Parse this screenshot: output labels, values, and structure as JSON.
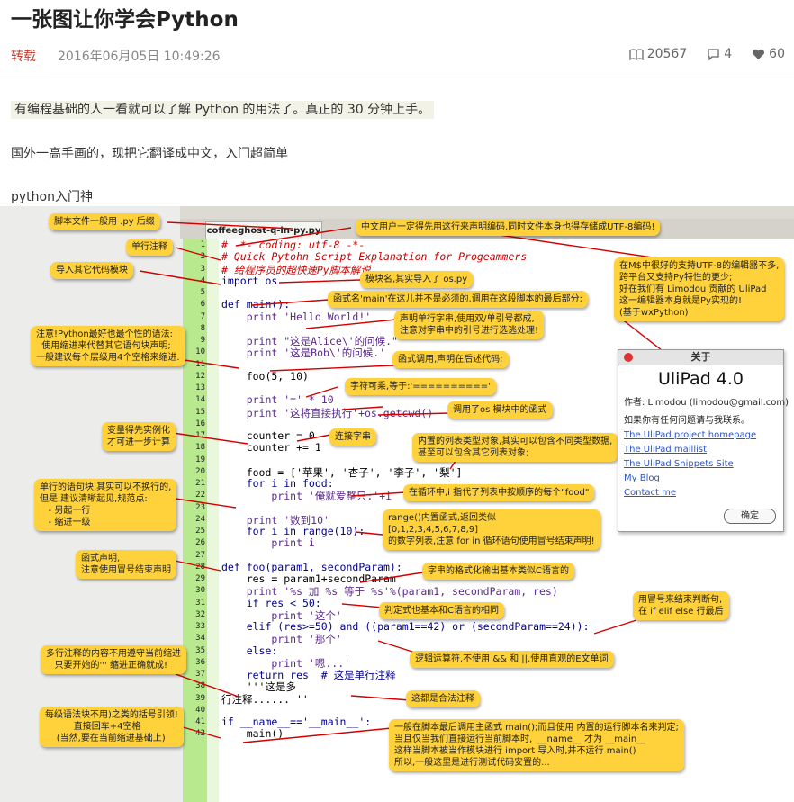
{
  "article": {
    "title": "一张图让你学会Python",
    "tag": "转载",
    "date": "2016年06月05日 10:49:26",
    "views": "20567",
    "comments": "4",
    "likes": "60",
    "para1": "有编程基础的人一看就可以了解 Python 的用法了。真正的 30 分钟上手。",
    "para2": "国外一高手画的，现把它翻译成中文，入门超简单",
    "para3": "python入门神"
  },
  "editor": {
    "tab": "coffeeghost-q-in-py.py",
    "line_numbers": [
      "1",
      "2",
      "3",
      "4",
      "5",
      "6",
      "7",
      "8",
      "9",
      "10",
      "11",
      "12",
      "13",
      "14",
      "15",
      "16",
      "17",
      "18",
      "19",
      "20",
      "21",
      "22",
      "23",
      "24",
      "25",
      "26",
      "27",
      "28",
      "29",
      "30",
      "31",
      "32",
      "33",
      "34",
      "35",
      "36",
      "37",
      "38",
      "39",
      "40",
      "41",
      "42"
    ],
    "lines": [
      "# -*- coding: utf-8 -*-",
      "# Quick Pytohn Script Explanation for Progeammers",
      "# 给程序员的超快速Py脚本解说",
      "import os",
      "",
      "def main():",
      "    print 'Hello World!'",
      "",
      "    print \"这是Alice\\'的问候.\"",
      "    print '这是Bob\\'的问候.'",
      "",
      "    foo(5, 10)",
      "",
      "    print '=' * 10",
      "    print '这将直接执行'+os.getcwd()",
      "",
      "    counter = 0",
      "    counter += 1",
      "",
      "    food = ['苹果', '杏子', '李子', '梨']",
      "    for i in food:",
      "        print '俺就爱整只:'+i",
      "",
      "    print '数到10'",
      "    for i in range(10):",
      "        print i",
      "",
      "def foo(param1, secondParam):",
      "    res = param1+secondParam",
      "    print '%s 加 %s 等于 %s'%(param1, secondParam, res)",
      "    if res < 50:",
      "        print '这个'",
      "    elif (res>=50) and ((param1==42) or (secondParam==24)):",
      "        print '那个'",
      "    else:",
      "        print '嗯...'",
      "    return res  # 这是单行注释",
      "    '''这是多",
      "行注释......'''",
      "",
      "if __name__=='__main__':",
      "    main()"
    ]
  },
  "notes": [
    "脚本文件一般用 .py 后缀",
    "中文用户一定得先用这行来声明编码,同时文件本身也得存储成UTF-8编码!",
    "单行注释",
    "导入其它代码模块",
    "模块名,其实导入了 os.py",
    "函式名'main'在这儿并不是必须的,调用在这段脚本的最后部分;",
    "在M$中很好的支持UTF-8的编辑器不多,\n跨平台又支持Py特性的更少;\n好在我们有 Limodou 贡献的 UliPad\n这一编辑器本身就是Py实现的!\n(基于wxPython)",
    "注意!Python最好也最个性的语法:\n  使用缩进来代替其它语句块声明;\n一般建议每个层级用4个空格来缩进.",
    "声明单行字串,使用双/单引号都成,\n注意对字串中的引号进行选逃处理!",
    "函式调用,声明在后述代码;",
    "字符可乘,等于:'=========='",
    "调用了os 模块中的函式",
    "变量得先实例化\n才可进一步计算",
    "连接字串",
    "内置的列表类型对象,其实可以包含不同类型数据,\n甚至可以包含其它列表对象;",
    "单行的语句块,其实可以不换行的,\n但是,建议清晰起见,规范点:\n   - 另起一行\n   - 缩进一级",
    "在循环中,i 指代了列表中按顺序的每个\"food\"",
    "range()内置函式,返回类似\n[0,1,2,3,4,5,6,7,8,9]\n的数字列表,注意 for in 循环语句使用冒号结束声明!",
    "函式声明,\n注意使用冒号结束声明",
    "字串的格式化输出基本类似C语言的",
    "判定式也基本和C语言的相同",
    "用冒号来结束判断句,\n在 if elif else 行最后",
    "逻辑运算符,不使用 && 和 ||,使用直观的E文单词",
    "多行注释的内容不用遵守当前缩进\n   只要开始的''' 缩进正确就成!",
    "这都是合法注释",
    "每级语法块不用)之类的括号引领!\n          直接回车+4空格\n    (当然,要在当前缩进基础上)",
    "一般在脚本最后调用主函式 main();而且使用 内置的运行脚本名来判定;\n当且仅当我们直接运行当前脚本时,  __name__ 才为 __main__\n这样当脚本被当作模块进行 import 导入时,并不运行 main()\n所以,一般这里是进行测试代码安置的..."
  ],
  "about": {
    "title": "关于",
    "version": "UliPad 4.0",
    "author": "作者: Limodou (limodou@gmail.com)",
    "contact": "如果你有任何问题请与我联系。",
    "links": [
      "The UliPad project homepage",
      "The UliPad maillist",
      "The UliPad Snippets Site",
      "My Blog",
      "Contact me"
    ],
    "ok": "确定"
  }
}
